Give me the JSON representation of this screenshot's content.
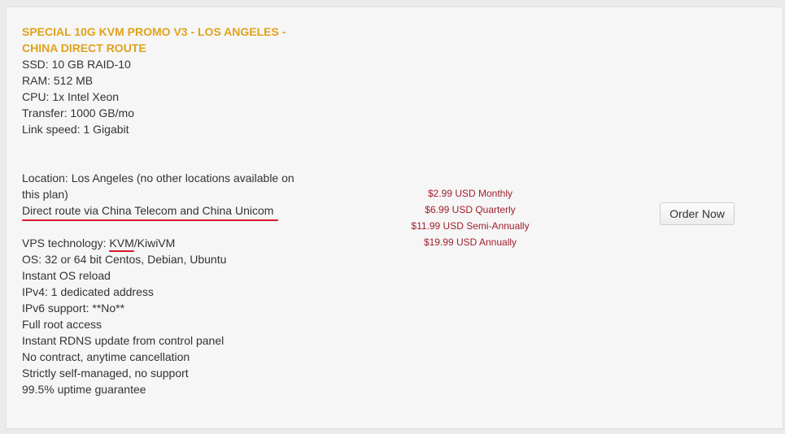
{
  "plan": {
    "title": "SPECIAL 10G KVM PROMO V3 - LOS ANGELES - CHINA DIRECT ROUTE",
    "specs": [
      "SSD: 10 GB RAID-10",
      "RAM: 512 MB",
      "CPU: 1x Intel Xeon",
      "Transfer: 1000 GB/mo",
      "Link speed: 1 Gigabit"
    ],
    "location": "Location: Los Angeles (no other locations available on this plan)",
    "direct_route": "Direct route via China Telecom and China Unicom",
    "vps_tech_prefix": "VPS technology: ",
    "vps_tech_kvm": "KVM",
    "vps_tech_suffix": "/KiwiVM",
    "features": [
      "OS: 32 or 64 bit Centos, Debian, Ubuntu",
      "Instant OS reload",
      "IPv4: 1 dedicated address",
      "IPv6 support: **No**",
      "Full root access",
      "Instant RDNS update from control panel",
      "No contract, anytime cancellation",
      "Strictly self-managed, no support",
      "99.5% uptime guarantee"
    ]
  },
  "pricing": [
    "$2.99 USD Monthly",
    "$6.99 USD Quarterly",
    "$11.99 USD Semi-Annually",
    "$19.99 USD Annually"
  ],
  "order_button": "Order Now",
  "colors": {
    "title": "#e0a21a",
    "price": "#a0202b",
    "annotation_underline": "#d7182a"
  }
}
